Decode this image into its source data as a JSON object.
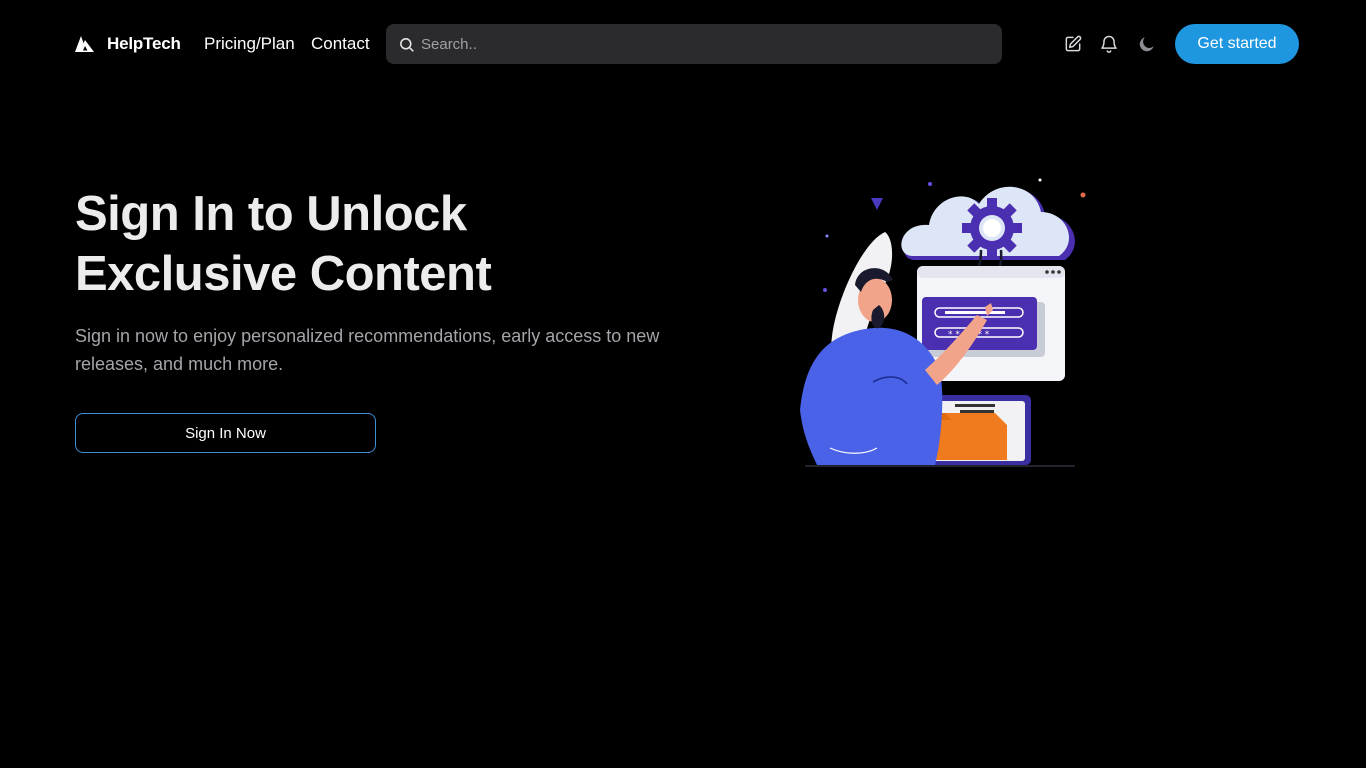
{
  "nav": {
    "brand": "HelpTech",
    "links": [
      "Pricing/Plan",
      "Contact"
    ],
    "search_placeholder": "Search..",
    "icons": [
      "edit-icon",
      "bell-icon",
      "moon-icon"
    ],
    "cta_label": "Get started"
  },
  "hero": {
    "title_line1": "Sign In to Unlock",
    "title_line2": "Exclusive Content",
    "subtitle": "Sign in now to enjoy personalized recommendations, early access to new releases, and much more.",
    "button_label": "Sign In Now",
    "illustration": "person-login-cloud-illustration"
  },
  "colors": {
    "background": "#000000",
    "accent": "#1e96e0",
    "search_bg": "#2b2b2d",
    "title": "#ececec",
    "subtitle": "#a4a4aa"
  }
}
